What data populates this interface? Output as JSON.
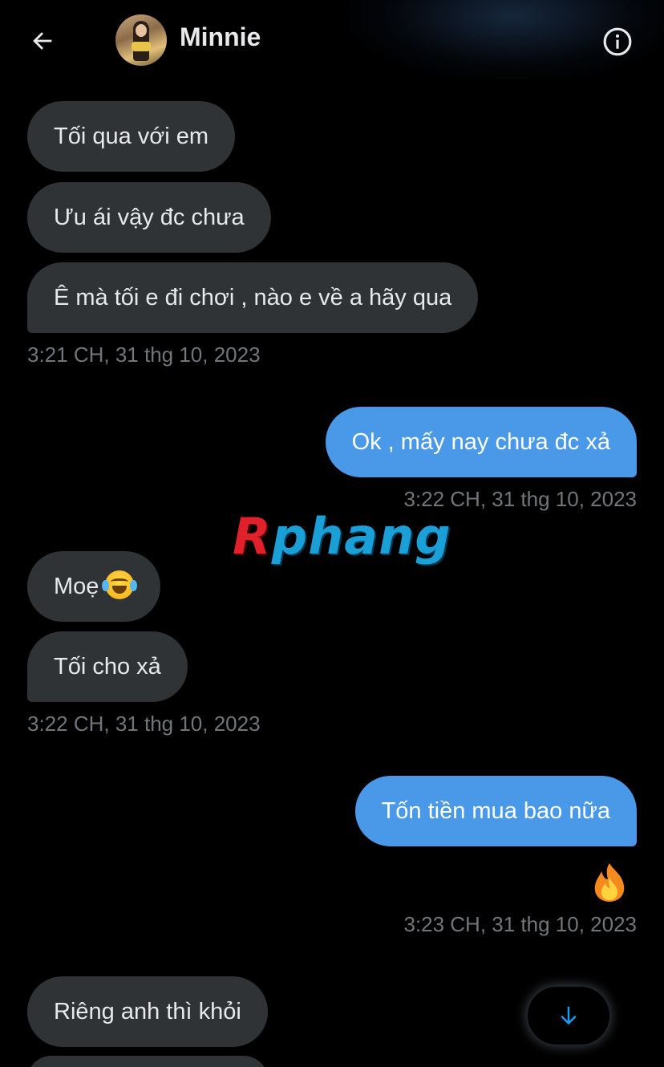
{
  "header": {
    "contact_name": "Minnie",
    "back_icon": "arrow-left-icon",
    "info_icon": "info-circle-icon"
  },
  "messages": [
    {
      "side": "in",
      "text": "Tối qua với em"
    },
    {
      "side": "in",
      "text": "Ưu ái vậy đc chưa"
    },
    {
      "side": "in",
      "text": "Ê mà tối e đi chơi , nào e về a hãy qua"
    },
    {
      "side": "out",
      "text": "Ok , mấy nay chưa đc xả"
    },
    {
      "side": "in",
      "text": "Moẹ"
    },
    {
      "side": "in",
      "text": "Tối cho xả"
    },
    {
      "side": "out",
      "text": "Tốn tiền mua bao nữa"
    },
    {
      "side": "in",
      "text": "Riêng anh thì khỏi"
    }
  ],
  "timestamps": [
    "3:21 CH, 31 thg 10, 2023",
    "3:22 CH, 31 thg 10, 2023",
    "3:22 CH, 31 thg 10, 2023",
    "3:23 CH, 31 thg 10, 2023"
  ],
  "reaction": "fire-emoji",
  "emoji_in_message": "face-with-tears-of-joy",
  "watermark": {
    "first": "R",
    "rest": "phang"
  },
  "scroll_button_icon": "arrow-down-icon",
  "colors": {
    "background": "#000000",
    "incoming_bubble": "#2f3336",
    "outgoing_bubble": "#4a99e9",
    "timestamp": "#71767b",
    "accent": "#1d9bf0"
  }
}
